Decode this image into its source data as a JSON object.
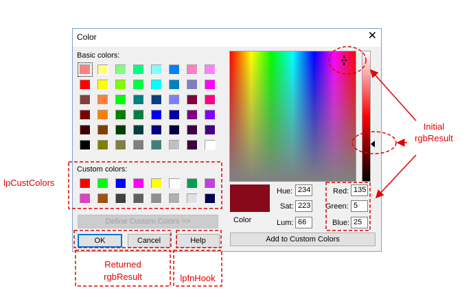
{
  "dialog": {
    "title": "Color",
    "close_glyph": "✕",
    "basic_colors_label": "Basic colors:",
    "custom_colors_label": "Custom colors:",
    "basic_colors": [
      [
        "#ff8080",
        "#ffff80",
        "#80ff80",
        "#00ff80",
        "#80ffff",
        "#0080ff",
        "#ff80c0",
        "#ff80ff"
      ],
      [
        "#ff0000",
        "#ffff00",
        "#80ff00",
        "#00ff40",
        "#00ffff",
        "#0080c0",
        "#8080c0",
        "#ff00ff"
      ],
      [
        "#804040",
        "#ff8040",
        "#00ff00",
        "#008080",
        "#004080",
        "#8080ff",
        "#800040",
        "#ff0080"
      ],
      [
        "#800000",
        "#ff8000",
        "#008000",
        "#008040",
        "#0000ff",
        "#0000a0",
        "#800080",
        "#8000ff"
      ],
      [
        "#400000",
        "#804000",
        "#004000",
        "#004040",
        "#000080",
        "#000040",
        "#400040",
        "#400080"
      ],
      [
        "#000000",
        "#808000",
        "#808040",
        "#808080",
        "#408080",
        "#c0c0c0",
        "#400040",
        "#ffffff"
      ]
    ],
    "custom_colors": [
      [
        "#ff0000",
        "#00ff00",
        "#0000ff",
        "#ff00ff",
        "#ffff00",
        "#ffffff",
        "#00a050",
        "#c040e0"
      ],
      [
        "#e040c0",
        "#a05010",
        "#404040",
        "#606060",
        "#909090",
        "#b0b0b0",
        "#e0e0e0",
        "#000050"
      ]
    ],
    "define_custom_colors_label": "Define Custom Colors >>",
    "ok_label": "OK",
    "cancel_label": "Cancel",
    "help_label": "Help",
    "add_to_custom_label": "Add to Custom Colors",
    "color_label": "Color",
    "hue_label": "Hue:",
    "hue_value": "234",
    "sat_label": "Sat:",
    "sat_value": "223",
    "lum_label": "Lum:",
    "lum_value": "66",
    "red_label": "Red:",
    "red_value": "135",
    "green_label": "Green:",
    "green_value": "5",
    "blue_label": "Blue:",
    "blue_value": "25",
    "preview_color": "#87091a"
  },
  "annotations": {
    "initial_line1": "Initial",
    "initial_line2": "rgbResult",
    "lpcustcolors": "lpCustColors",
    "returned_line1": "Returned",
    "returned_line2": "rgbResult",
    "lpfnhook": "lpfnHook",
    "color": "#e00000"
  }
}
